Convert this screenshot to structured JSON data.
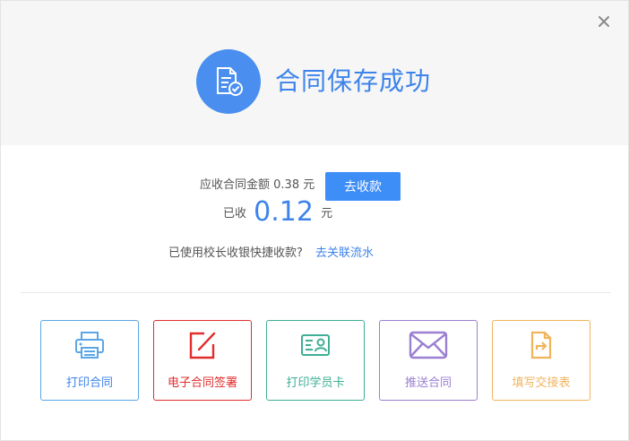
{
  "dialog": {
    "title": "合同保存成功",
    "close_symbol": "×"
  },
  "payment": {
    "receivable_label": "应收合同金额",
    "receivable_amount": "0.38",
    "currency": "元",
    "pay_button_label": "去收款",
    "received_label": "已收",
    "received_amount": "0.12"
  },
  "quick": {
    "text": "已使用校长收银快捷收款?",
    "link": "去关联流水"
  },
  "actions": [
    {
      "label": "打印合同",
      "icon": "printer-icon",
      "color": "#5aa6e6"
    },
    {
      "label": "电子合同签署",
      "icon": "sign-icon",
      "color": "#e02d2d"
    },
    {
      "label": "打印学员卡",
      "icon": "id-card-icon",
      "color": "#3fae93"
    },
    {
      "label": "推送合同",
      "icon": "envelope-icon",
      "color": "#9b7fd1"
    },
    {
      "label": "填写交接表",
      "icon": "file-export-icon",
      "color": "#f0b45c"
    }
  ]
}
